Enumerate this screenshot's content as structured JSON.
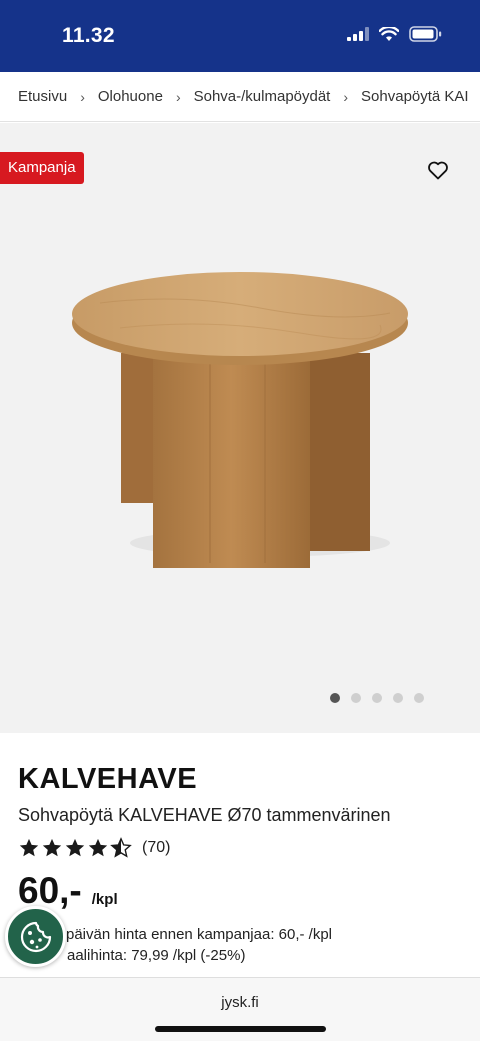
{
  "status": {
    "time": "11.32"
  },
  "breadcrumb": [
    "Etusivu",
    "Olohuone",
    "Sohva-/kulmapöydät",
    "Sohvapöytä KAI"
  ],
  "gallery": {
    "badge": "Kampanja",
    "slide_count": 5,
    "active_slide": 1
  },
  "product": {
    "brand": "KALVEHAVE",
    "name": "Sohvapöytä KALVEHAVE Ø70 tammenvärinen",
    "rating": 4.5,
    "rating_count": "(70)",
    "price": "60,-",
    "unit": "/kpl",
    "prev_price_text": "päivän hinta ennen kampanjaa: 60,- /kpl",
    "normal_price_text": "aalihinta: 79,99 /kpl (-25%)"
  },
  "browser": {
    "url": "jysk.fi"
  },
  "colors": {
    "header": "#15338a",
    "badge": "#d71920",
    "cookie": "#22634a"
  }
}
